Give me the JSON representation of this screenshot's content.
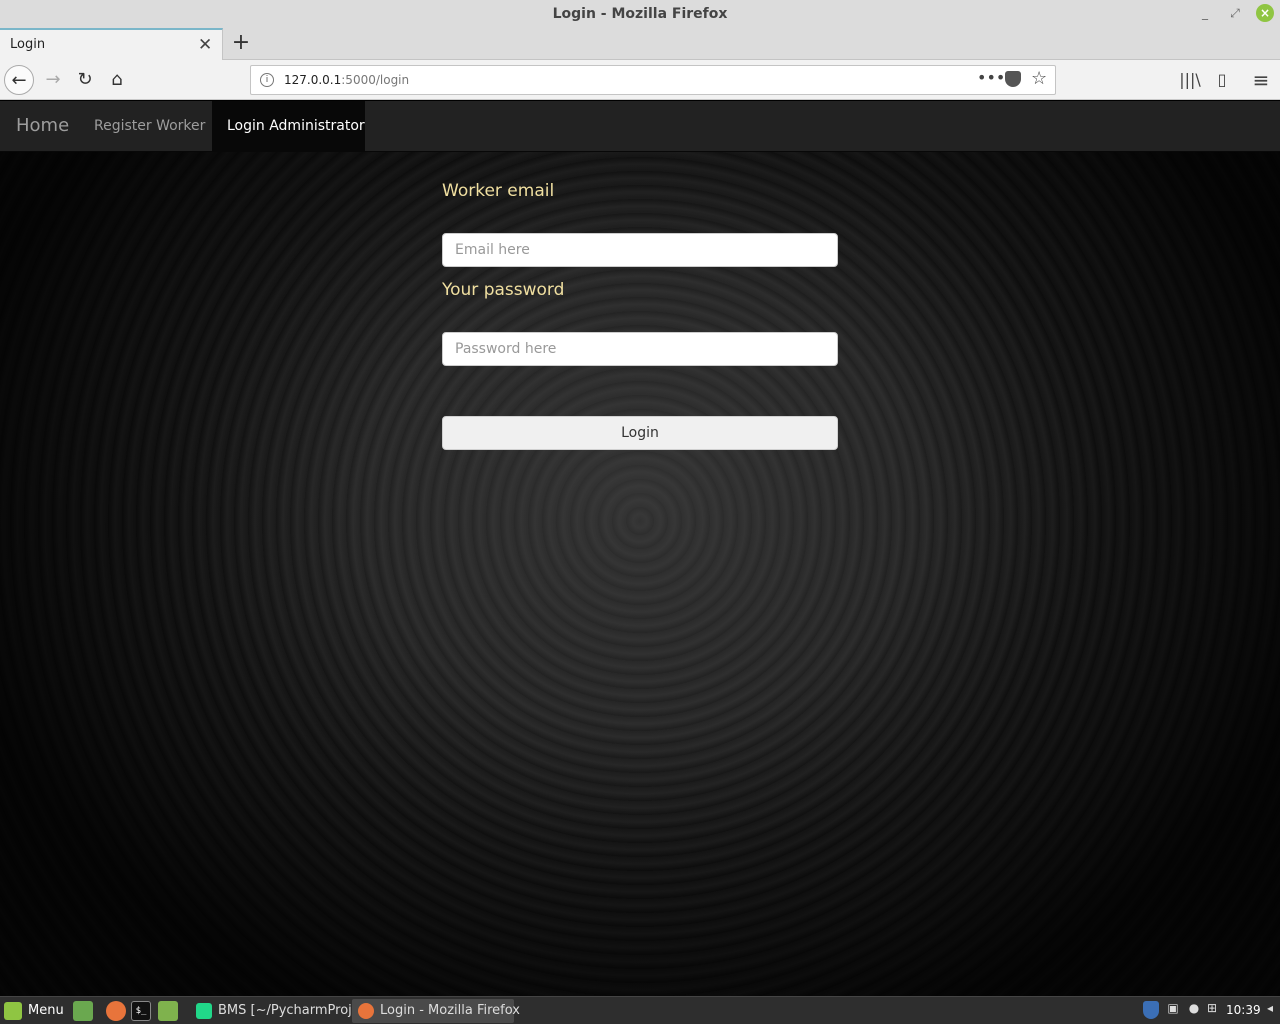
{
  "window": {
    "title": "Login - Mozilla Firefox"
  },
  "browser": {
    "tab_label": "Login",
    "new_tab_symbol": "+",
    "url_host": "127.0.0.1",
    "url_path": ":5000/login",
    "more_symbol": "•••"
  },
  "site_nav": {
    "brand": "Home",
    "items": [
      {
        "label": "Register Worker"
      },
      {
        "label": "Login Administrator"
      }
    ]
  },
  "form": {
    "email_label": "Worker email",
    "email_placeholder": "Email here",
    "password_label": "Your password",
    "password_placeholder": "Password here",
    "submit_label": "Login"
  },
  "taskbar": {
    "menu_label": "Menu",
    "terminal_glyph": "$_",
    "windows": [
      {
        "label": "BMS [~/PycharmProj..."
      },
      {
        "label": "Login - Mozilla Firefox"
      }
    ],
    "clock": "10:39"
  },
  "colors": {
    "label_text": "#f0dfa0",
    "nav_bg": "#222222",
    "nav_active_bg": "#080808",
    "mint_green": "#8fc542"
  },
  "icons": [
    "minimize-icon",
    "maximize-icon",
    "close-window-icon",
    "tab-close-icon",
    "back-arrow-icon",
    "forward-arrow-icon",
    "reload-icon",
    "home-icon",
    "info-icon",
    "page-actions-icon",
    "pocket-icon",
    "bookmark-star-icon",
    "library-icon",
    "sidebar-icon",
    "hamburger-menu-icon"
  ]
}
